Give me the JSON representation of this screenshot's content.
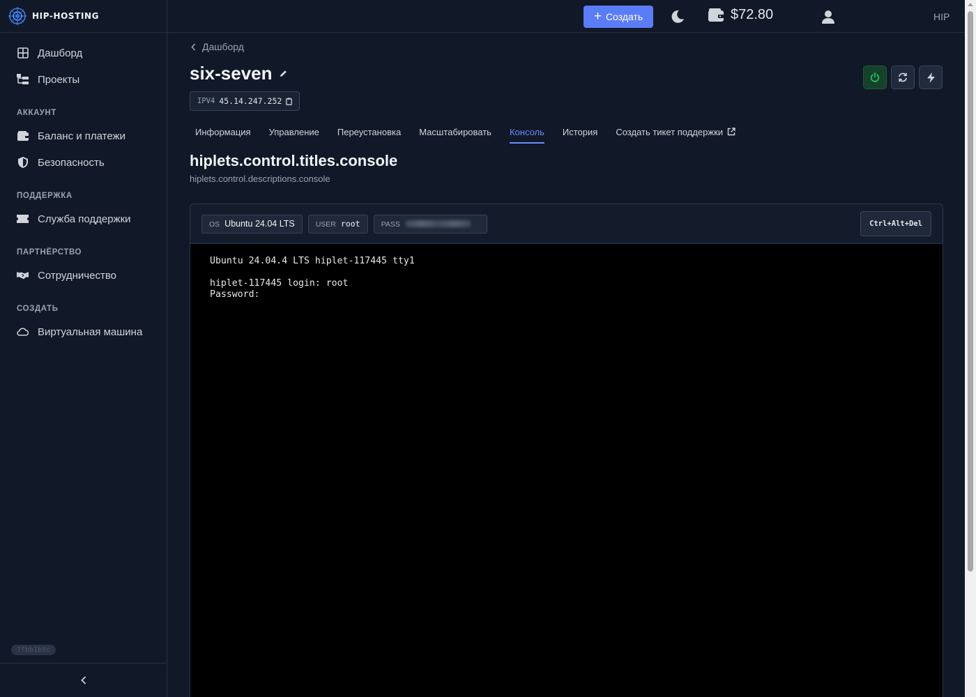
{
  "brand": {
    "name": "HIP-HOSTING"
  },
  "sidebar": {
    "top_items": [
      {
        "label": "Дашборд",
        "icon": "dashboard-icon"
      },
      {
        "label": "Проекты",
        "icon": "projects-icon"
      }
    ],
    "sections": [
      {
        "title": "АККАУНТ",
        "items": [
          {
            "label": "Баланс и платежи",
            "icon": "wallet-icon"
          },
          {
            "label": "Безопасность",
            "icon": "shield-icon"
          }
        ]
      },
      {
        "title": "ПОДДЕРЖКА",
        "items": [
          {
            "label": "Служба поддержки",
            "icon": "ticket-icon"
          }
        ]
      },
      {
        "title": "ПАРТНЁРСТВО",
        "items": [
          {
            "label": "Сотрудничество",
            "icon": "handshake-icon"
          }
        ]
      },
      {
        "title": "СОЗДАТЬ",
        "items": [
          {
            "label": "Виртуальная машина",
            "icon": "cloud-icon"
          }
        ]
      }
    ],
    "version": "7fbb1b9c"
  },
  "header": {
    "create_label": "Создать",
    "balance": "$72.80",
    "user_short": "HIP"
  },
  "page": {
    "back_label": "Дашборд",
    "title": "six-seven",
    "ip_label": "IPV4",
    "ip_value": "45.14.247.252",
    "tabs": [
      {
        "label": "Информация"
      },
      {
        "label": "Управление"
      },
      {
        "label": "Переустановка"
      },
      {
        "label": "Масштабировать"
      },
      {
        "label": "Консоль",
        "active": true
      },
      {
        "label": "История"
      },
      {
        "label": "Создать тикет поддержки",
        "external": true
      }
    ],
    "section_title": "hiplets.control.titles.console",
    "section_desc": "hiplets.control.descriptions.console"
  },
  "console": {
    "os_label": "OS",
    "os_value": "Ubuntu 24.04 LTS",
    "user_label": "USER",
    "user_value": "root",
    "pass_label": "PASS",
    "cad_label": "Ctrl+Alt+Del",
    "lines": [
      "Ubuntu 24.04.4 LTS hiplet-117445 tty1",
      "",
      "hiplet-117445 login: root",
      "Password:"
    ]
  },
  "colors": {
    "accent": "#5b7cf7",
    "active_tab": "#6b8cff",
    "power": "#22c55e",
    "background": "#111827"
  }
}
